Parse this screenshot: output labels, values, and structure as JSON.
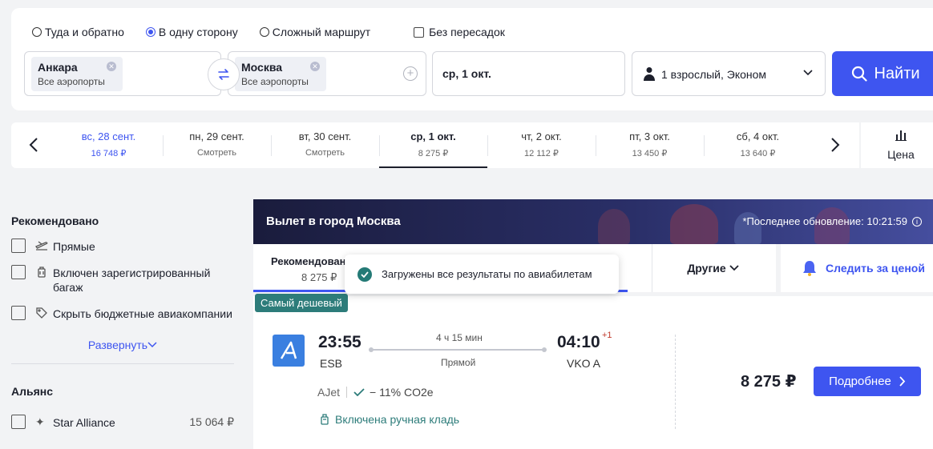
{
  "search": {
    "trip_types": [
      {
        "label": "Туда и обратно",
        "selected": false
      },
      {
        "label": "В одну сторону",
        "selected": true
      },
      {
        "label": "Сложный маршрут",
        "selected": false
      }
    ],
    "nonstop_label": "Без пересадок",
    "from": {
      "city": "Анкара",
      "sub": "Все аэропорты"
    },
    "to": {
      "city": "Москва",
      "sub": "Все аэропорты"
    },
    "date": "ср, 1 окт.",
    "passengers": "1 взрослый, Эконом",
    "search_button": "Найти"
  },
  "date_strip": {
    "days": [
      {
        "date": "вс, 28 сент.",
        "price": "16 748 ₽",
        "state": "blue"
      },
      {
        "date": "пн, 29 сент.",
        "price": "Смотреть",
        "state": ""
      },
      {
        "date": "вт, 30 сент.",
        "price": "Смотреть",
        "state": ""
      },
      {
        "date": "ср, 1 окт.",
        "price": "8 275 ₽",
        "state": "active"
      },
      {
        "date": "чт, 2 окт.",
        "price": "12 112 ₽",
        "state": ""
      },
      {
        "date": "пт, 3 окт.",
        "price": "13 450 ₽",
        "state": ""
      },
      {
        "date": "сб, 4 окт.",
        "price": "13 640 ₽",
        "state": ""
      }
    ],
    "price_tab_label": "Цена"
  },
  "filters": {
    "recommended_title": "Рекомендовано",
    "items": [
      {
        "label": "Прямые"
      },
      {
        "label": "Включен зарегистрированный багаж"
      },
      {
        "label": "Скрыть бюджетные авиакомпании"
      }
    ],
    "expand_label": "Развернуть",
    "alliance_title": "Альянс",
    "alliance_row": {
      "label": "Star Alliance",
      "price": "15 064 ₽"
    }
  },
  "results": {
    "banner_title": "Вылет в город Москва",
    "last_update": "*Последнее обновление: 10:21:59",
    "sort_tabs": {
      "recommended": "Рекомендовано",
      "recommended_price": "8 275 ₽",
      "middle_tail": "ие",
      "other": "Другие",
      "track": "Следить за ценой"
    },
    "toast": "Загружены все результаты по авиабилетам",
    "flight": {
      "badge": "Самый дешевый",
      "dep_time": "23:55",
      "dep_airport": "ESB",
      "duration": "4 ч 15 мин",
      "stops": "Прямой",
      "arr_time": "04:10",
      "arr_plus": "+1",
      "arr_airport": "VKO A",
      "airline": "AJet",
      "co2": "− 11% CO2e",
      "baggage": "Включена ручная кладь",
      "price": "8 275 ₽",
      "details_button": "Подробнее"
    }
  },
  "colors": {
    "accent": "#3e55f0",
    "badge": "#2d7c7a",
    "banner": "#1a1c3c"
  }
}
